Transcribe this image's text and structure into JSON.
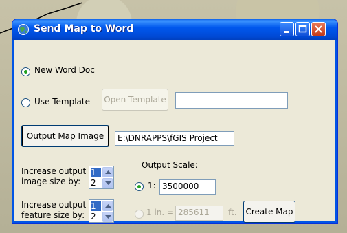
{
  "window": {
    "title": "Send Map to Word"
  },
  "options": {
    "new_doc": "New Word Doc",
    "use_template": "Use Template",
    "open_template": "Open Template",
    "template_path": ""
  },
  "output": {
    "button": "Output Map Image",
    "path": "E:\\DNRAPPS\\fGIS Project"
  },
  "image_size": {
    "label_line1": "Increase output",
    "label_line2": "image size by:",
    "values": [
      "1",
      "2"
    ],
    "selected": "1"
  },
  "feature_size": {
    "label_line1": "Increase output",
    "label_line2": "feature size by:",
    "values": [
      "1",
      "2"
    ],
    "selected": "1"
  },
  "scale": {
    "title": "Output Scale:",
    "ratio_label": "1:",
    "ratio_value": "3500000",
    "inch_label": "1 in. =",
    "inch_value": "285611",
    "unit": "ft."
  },
  "create_button": "Create Map"
}
